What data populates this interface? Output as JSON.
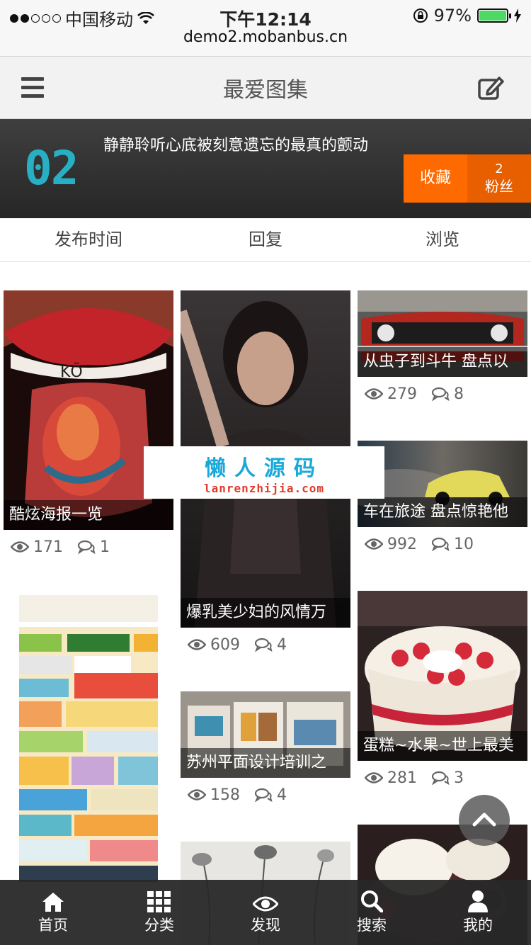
{
  "status_bar": {
    "carrier": "中国移动",
    "time": "下午12:14",
    "battery": "97%",
    "url": "demo2.mobanbus.cn"
  },
  "header": {
    "title": "最爱图集"
  },
  "profile": {
    "logo_text": "02",
    "description": "静静聆听心底被刻意遗忘的最真的颤动",
    "favorite_label": "收藏",
    "fans_count": "2",
    "fans_label": "粉丝"
  },
  "sort_tabs": [
    "发布时间",
    "回复",
    "浏览"
  ],
  "posts": [
    {
      "title": "酷炫海报一览",
      "views": "171",
      "comments": "1"
    },
    {
      "title": "爆乳美少妇的风情万",
      "views": "609",
      "comments": "4"
    },
    {
      "title": "从虫子到斗牛 盘点以",
      "views": "279",
      "comments": "8"
    },
    {
      "title": "车在旅途 盘点惊艳他",
      "views": "992",
      "comments": "10"
    },
    {
      "title": "苏州平面设计培训之",
      "views": "158",
      "comments": "4"
    },
    {
      "title": "蛋糕~水果~世上最美",
      "views": "281",
      "comments": "3"
    }
  ],
  "watermark": {
    "main": "懒人源码",
    "sub": "lanrenzhijia.com"
  },
  "bottom_nav": [
    "首页",
    "分类",
    "发现",
    "搜索",
    "我的"
  ],
  "colors": {
    "accent": "#ff6a00",
    "accent_dark": "#e85f00",
    "logo": "#27b0c3",
    "nav_bg": "#282828"
  }
}
